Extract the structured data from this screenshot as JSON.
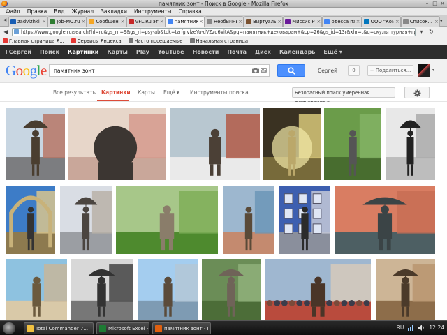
{
  "window": {
    "title": "памятник зонт - Поиск в Google - Mozilla Firefox",
    "buttons": [
      "–",
      "□",
      "×"
    ]
  },
  "menu": [
    "Файл",
    "Правка",
    "Вид",
    "Журнал",
    "Закладки",
    "Инструменты",
    "Справка"
  ],
  "tabs": [
    {
      "label": "zadvizhki_30...",
      "color": "#1a5fb4",
      "active": false
    },
    {
      "label": "Job-MO.ru ...",
      "color": "#2e7d32",
      "active": false
    },
    {
      "label": "Сообщение...",
      "color": "#f5a623",
      "active": false
    },
    {
      "label": "VFL.Ru это, ...",
      "color": "#c62828",
      "active": false
    },
    {
      "label": "памятник ...",
      "color": "#4285f4",
      "active": true
    },
    {
      "label": "Необычные...",
      "color": "#888888",
      "active": false
    },
    {
      "label": "Виртуально...",
      "color": "#7a5230",
      "active": false
    },
    {
      "label": "Миссис Рос...",
      "color": "#6a1b9a",
      "active": false
    },
    {
      "label": "одесса пам...",
      "color": "#4285f4",
      "active": false
    },
    {
      "label": "ООО \"Комп...",
      "color": "#0277bd",
      "active": false
    },
    {
      "label": "Список...",
      "color": "#888888",
      "active": false
    }
  ],
  "url": "https://www.google.ru/search?hl=ru&gs_rn=9&gs_ri=psy-ab&tok=tzrfgivlzeYu-dVZzd6VitA&pq=памятник+деловарам+&cp=26&gs_id=13r&xhr=t&q=скульптурная+группа+зонтик&newwindow",
  "bookmarks": [
    {
      "label": "Главная страница Я...",
      "color": "#e53935"
    },
    {
      "label": "Сервисы Яндекса",
      "color": "#e53935"
    },
    {
      "label": "Часто посещаемые",
      "color": "#777777"
    },
    {
      "label": "Начальная страница",
      "color": "#777777"
    }
  ],
  "google_bar": [
    "+Сергей",
    "Поиск",
    "Картинки",
    "Карты",
    "Play",
    "YouTube",
    "Новости",
    "Почта",
    "Диск",
    "Календарь",
    "Ещё ▾"
  ],
  "google_bar_active": 2,
  "logo_letters": [
    {
      "ch": "G",
      "color": "#4285f4"
    },
    {
      "ch": "o",
      "color": "#ea4335"
    },
    {
      "ch": "o",
      "color": "#fbbc05"
    },
    {
      "ch": "g",
      "color": "#4285f4"
    },
    {
      "ch": "l",
      "color": "#34a853"
    },
    {
      "ch": "e",
      "color": "#ea4335"
    }
  ],
  "search": {
    "query": "памятник зонт"
  },
  "user": {
    "name": "Сергей",
    "notifications": "0",
    "share_label": "+ Поделиться..."
  },
  "subnav": {
    "all": "Все результаты",
    "images": "Картинки",
    "maps": "Карты",
    "more": "Ещё ▾",
    "tools": "Инструменты поиска",
    "safe_search": "Безопасный поиск умеренная фильтрация ▾"
  },
  "taskbar": {
    "tasks": [
      {
        "label": "Total Commander 7...",
        "color": "#f0c040"
      },
      {
        "label": "Microsoft Excel - Та...",
        "color": "#1e7b34"
      },
      {
        "label": "памятник зонт - П...",
        "color": "#e0600f"
      }
    ],
    "lang": "RU",
    "clock": "12:24"
  }
}
